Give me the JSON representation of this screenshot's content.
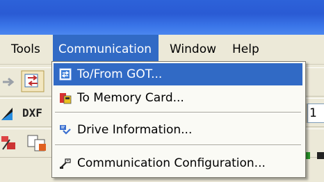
{
  "menubar": {
    "items": [
      {
        "label": "Tools"
      },
      {
        "label": "Communication"
      },
      {
        "label": "Window"
      },
      {
        "label": "Help"
      }
    ]
  },
  "toolbar": {
    "dxf_label": "DXF",
    "combo_value": "1"
  },
  "communication_menu": {
    "items": [
      {
        "label": "To/From GOT...",
        "icon": "to-from-got-icon"
      },
      {
        "label": "To Memory Card...",
        "icon": "memory-card-icon"
      },
      {
        "label": "Drive Information...",
        "icon": "drive-information-icon"
      },
      {
        "label": "Communication Configuration...",
        "icon": "communication-configuration-icon"
      }
    ]
  },
  "colors": {
    "title_bar": "#2a5bd4",
    "menu_highlight": "#316ac5",
    "menu_background": "#ece9d8"
  }
}
